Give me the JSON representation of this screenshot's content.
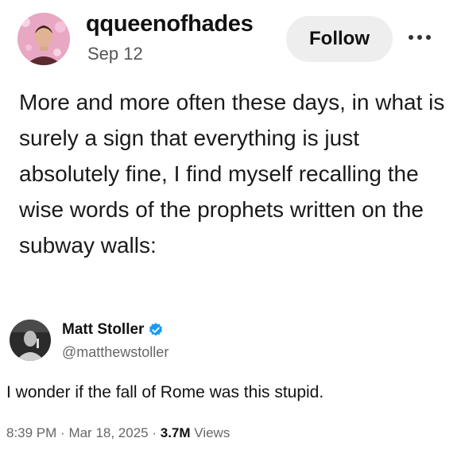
{
  "post": {
    "username": "qqueenofhades",
    "date": "Sep 12",
    "follow_label": "Follow",
    "more_icon": "more-dots-icon",
    "text": "More and more often these days, in what is surely a sign that everything is just absolutely fine, I find myself recalling the wise words of the prophets written on the subway walls:"
  },
  "quoted_tweet": {
    "display_name": "Matt Stoller",
    "verified_icon": "verified-badge-icon",
    "verified_color": "#1d9bf0",
    "handle": "@matthewstoller",
    "text": "I wonder if the fall of Rome was this stupid.",
    "time": "8:39 PM",
    "date": "Mar 18, 2025",
    "views_count": "3.7M",
    "views_label": "Views"
  }
}
